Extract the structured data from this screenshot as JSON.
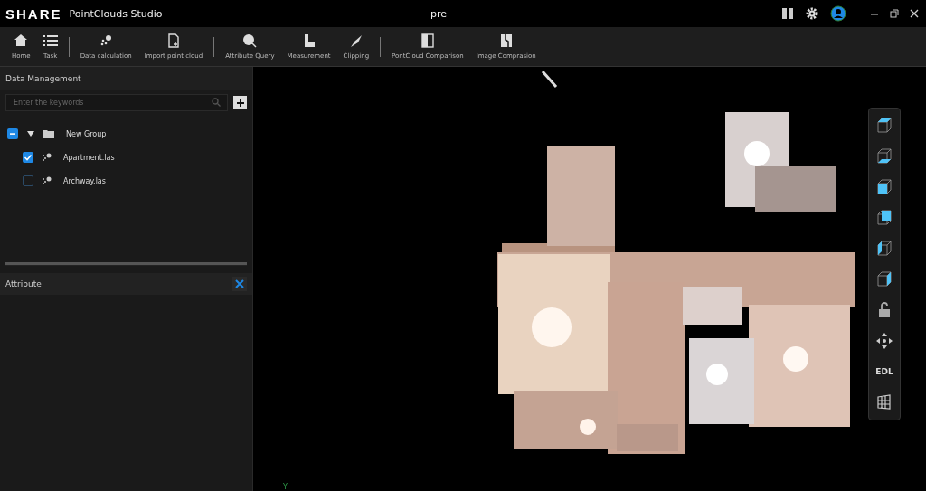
{
  "window": {
    "logo": "SHARE",
    "app_name": "PointClouds Studio",
    "title": "pre"
  },
  "toolbar": {
    "groups": [
      [
        {
          "label": "Home"
        },
        {
          "label": "Task"
        }
      ],
      [
        {
          "label": "Data calculation"
        },
        {
          "label": "Import point cloud"
        }
      ],
      [
        {
          "label": "Attribute Query"
        },
        {
          "label": "Measurement"
        },
        {
          "label": "Clipping"
        }
      ],
      [
        {
          "label": "PontCloud Comparison"
        },
        {
          "label": "Image Comprasion"
        }
      ]
    ]
  },
  "data_panel": {
    "title": "Data Management",
    "search": {
      "placeholder": "Enter the keywords"
    },
    "tree": [
      {
        "label": "New Group",
        "indeterminate": true,
        "expanded": true,
        "children": [
          {
            "label": "Apartment.las",
            "checked": true
          },
          {
            "label": "Archway.las",
            "checked": false
          }
        ]
      }
    ]
  },
  "attribute_panel": {
    "title": "Attribute"
  },
  "viewport": {
    "axis_label": "Y",
    "view_tools": [
      {
        "kind": "cube-top"
      },
      {
        "kind": "cube-bottom"
      },
      {
        "kind": "cube-front"
      },
      {
        "kind": "cube-back"
      },
      {
        "kind": "cube-left"
      },
      {
        "kind": "cube-right"
      },
      {
        "kind": "lock"
      },
      {
        "kind": "move"
      },
      {
        "kind": "text",
        "label": "EDL"
      },
      {
        "kind": "grid"
      }
    ]
  }
}
